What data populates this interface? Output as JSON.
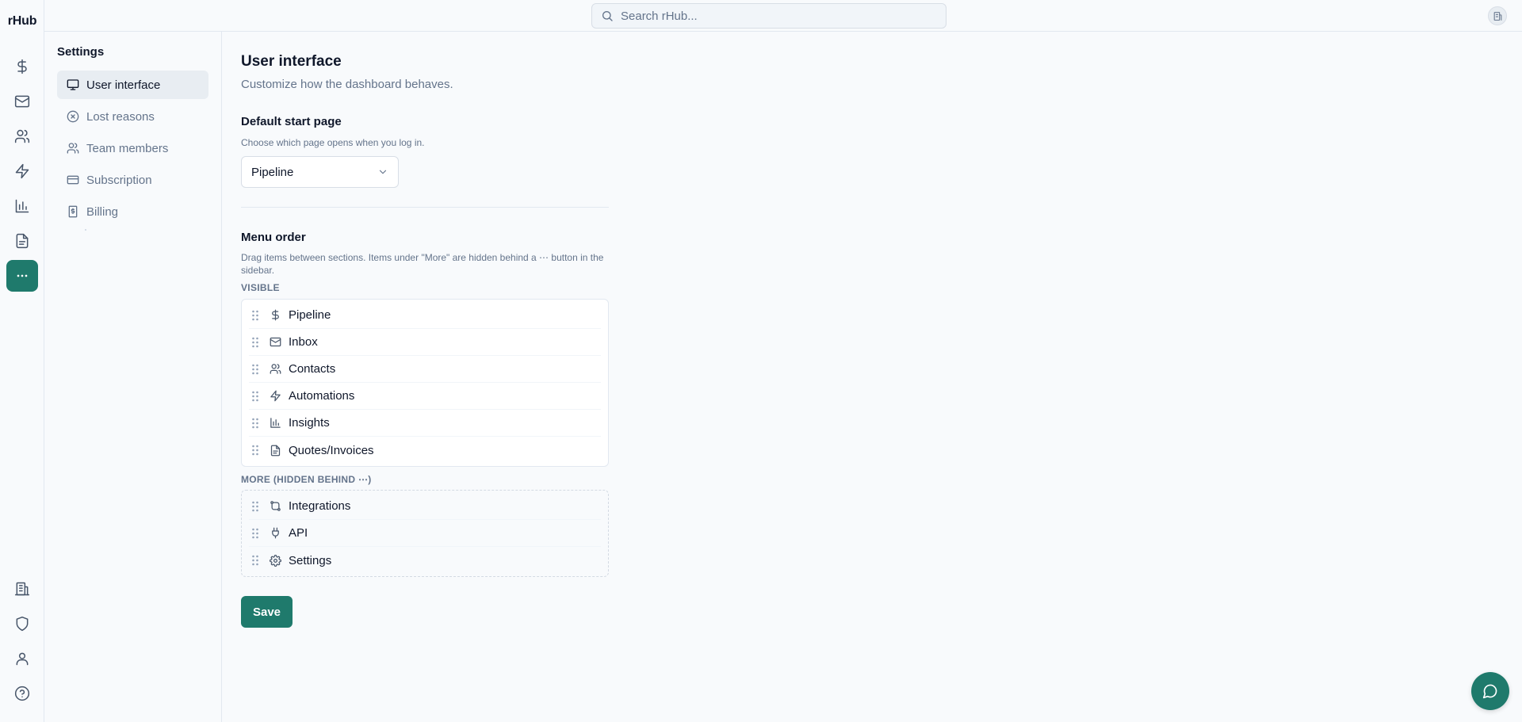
{
  "app": {
    "logo": "rHub"
  },
  "search": {
    "placeholder": "Search rHub..."
  },
  "rail": {
    "top": [
      "dollar-icon",
      "mail-icon",
      "users-icon",
      "zap-icon",
      "bar-chart-icon",
      "file-text-icon",
      "more-horizontal-icon"
    ],
    "bottom": [
      "building-icon",
      "shield-icon",
      "user-icon",
      "help-circle-icon"
    ],
    "active": "more-horizontal-icon"
  },
  "settings_nav": {
    "title": "Settings",
    "items": [
      {
        "label": "User interface",
        "icon": "monitor-icon",
        "active": true
      },
      {
        "label": "Lost reasons",
        "icon": "x-circle-icon"
      },
      {
        "label": "Team members",
        "icon": "users-icon"
      },
      {
        "label": "Subscription",
        "icon": "credit-card-icon"
      },
      {
        "label": "Billing",
        "icon": "receipt-icon"
      }
    ]
  },
  "main": {
    "title": "User interface",
    "subtitle": "Customize how the dashboard behaves.",
    "start_page": {
      "title": "Default start page",
      "help": "Choose which page opens when you log in.",
      "selected": "Pipeline"
    },
    "menu_order": {
      "title": "Menu order",
      "help": "Drag items between sections. Items under \"More\" are hidden behind a ⋯ button in the sidebar.",
      "visible_label": "VISIBLE",
      "visible": [
        {
          "label": "Pipeline",
          "icon": "dollar-icon"
        },
        {
          "label": "Inbox",
          "icon": "mail-icon"
        },
        {
          "label": "Contacts",
          "icon": "users-icon"
        },
        {
          "label": "Automations",
          "icon": "zap-icon"
        },
        {
          "label": "Insights",
          "icon": "bar-chart-icon"
        },
        {
          "label": "Quotes/Invoices",
          "icon": "file-text-icon"
        }
      ],
      "more_label": "MORE (HIDDEN BEHIND ⋯)",
      "more": [
        {
          "label": "Integrations",
          "icon": "workflow-icon"
        },
        {
          "label": "API",
          "icon": "plug-icon"
        },
        {
          "label": "Settings",
          "icon": "gear-icon"
        }
      ]
    },
    "save_label": "Save"
  },
  "colors": {
    "accent": "#1f7a6c",
    "muted": "#64748b",
    "border": "#e2e8f0"
  }
}
